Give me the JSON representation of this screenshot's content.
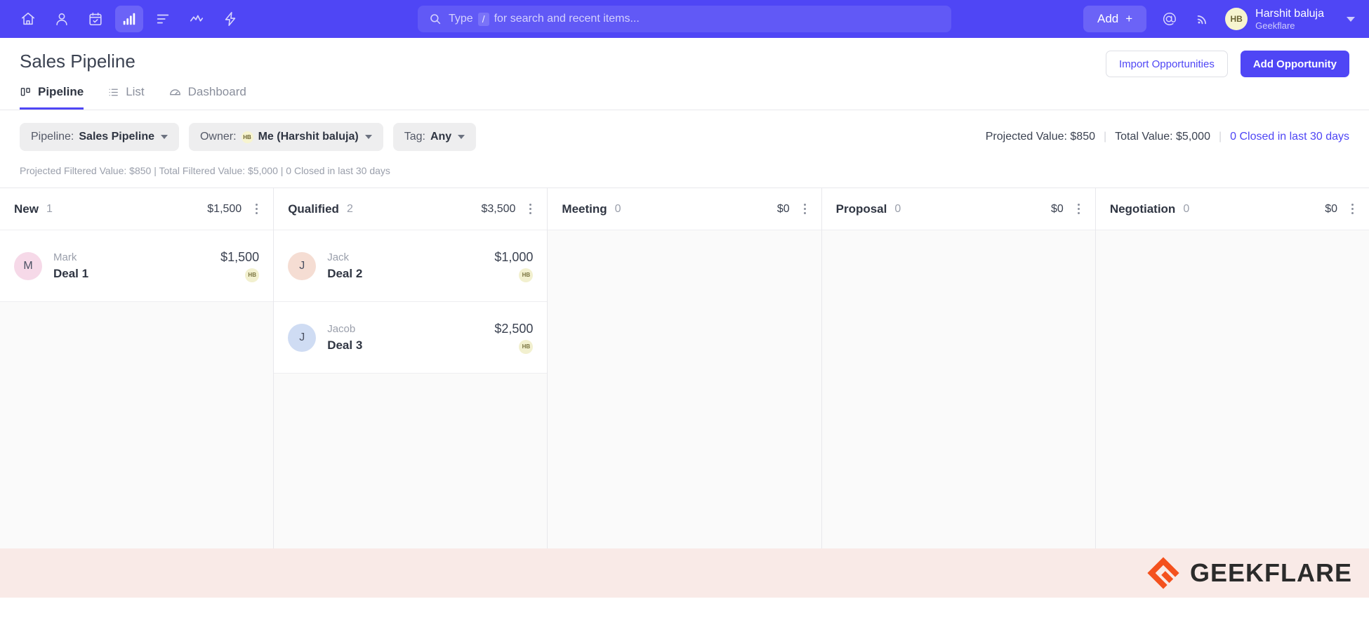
{
  "topnav": {
    "icons": [
      {
        "name": "home-icon",
        "active": false
      },
      {
        "name": "contacts-icon",
        "active": false
      },
      {
        "name": "calendar-icon",
        "active": false
      },
      {
        "name": "pipeline-chart-icon",
        "active": true
      },
      {
        "name": "tasks-list-icon",
        "active": false
      },
      {
        "name": "reports-trend-icon",
        "active": false
      },
      {
        "name": "automation-bolt-icon",
        "active": false
      }
    ],
    "search": {
      "placeholder_prefix": "Type",
      "slash_key": "/",
      "placeholder_suffix": "for search and recent items..."
    },
    "add_label": "Add",
    "add_plus": "+",
    "mention_icon": "at-mention-icon",
    "feed_icon": "broadcast-icon",
    "user": {
      "initials": "HB",
      "name": "Harshit baluja",
      "org": "Geekflare"
    }
  },
  "page": {
    "title": "Sales Pipeline",
    "tabs": [
      {
        "label": "Pipeline",
        "icon": "kanban-icon",
        "active": true
      },
      {
        "label": "List",
        "icon": "list-icon",
        "active": false
      },
      {
        "label": "Dashboard",
        "icon": "gauge-icon",
        "active": false
      }
    ],
    "import_label": "Import Opportunities",
    "add_opportunity_label": "Add Opportunity",
    "stats": {
      "projected": "Projected Value: $850",
      "total": "Total Value: $5,000",
      "closed": "0 Closed in last 30 days"
    }
  },
  "filters": [
    {
      "label": "Pipeline:",
      "value": "Sales Pipeline",
      "avatar": null
    },
    {
      "label": "Owner:",
      "value": "Me (Harshit baluja)",
      "avatar": "HB"
    },
    {
      "label": "Tag:",
      "value": "Any",
      "avatar": null
    }
  ],
  "filtered_summary": "Projected Filtered Value: $850 | Total Filtered Value: $5,000 | 0 Closed in last 30 days",
  "board": {
    "columns": [
      {
        "name": "New",
        "count": "1",
        "value": "$1,500",
        "cards": [
          {
            "contact": "Mark",
            "title": "Deal 1",
            "amount": "$1,500",
            "initial": "M",
            "avatar_color": "#f6d9e8",
            "owner": "HB"
          }
        ]
      },
      {
        "name": "Qualified",
        "count": "2",
        "value": "$3,500",
        "cards": [
          {
            "contact": "Jack",
            "title": "Deal 2",
            "amount": "$1,000",
            "initial": "J",
            "avatar_color": "#f5ddd3",
            "owner": "HB"
          },
          {
            "contact": "Jacob",
            "title": "Deal 3",
            "amount": "$2,500",
            "initial": "J",
            "avatar_color": "#cfdcf3",
            "owner": "HB"
          }
        ]
      },
      {
        "name": "Meeting",
        "count": "0",
        "value": "$0",
        "cards": []
      },
      {
        "name": "Proposal",
        "count": "0",
        "value": "$0",
        "cards": []
      },
      {
        "name": "Negotiation",
        "count": "0",
        "value": "$0",
        "cards": []
      }
    ]
  },
  "footer": {
    "brand": "GEEKFLARE",
    "logo_color": "#f4511e",
    "background": "#f9eae7"
  },
  "colors": {
    "nav_blue": "#4f46f5",
    "accent": "#4f46f5",
    "muted": "#9a9fab"
  }
}
